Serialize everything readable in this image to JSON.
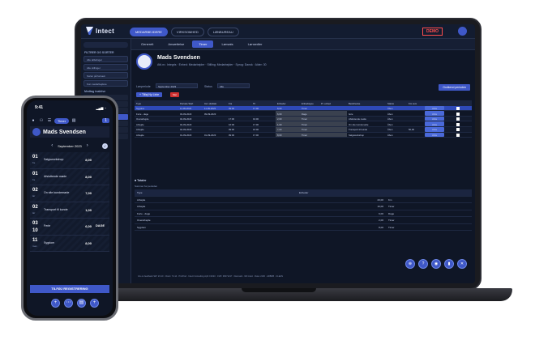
{
  "app": {
    "logo": "Intect",
    "demo_badge": "DEMO"
  },
  "topnav": [
    "MEDARBEJDERE",
    "VIRKSOMHED",
    "LØNBUREAU"
  ],
  "tabs": [
    "Generelt",
    "Ansættelse",
    "Timer",
    "Lønsats",
    "Lønsedler"
  ],
  "sidebar": {
    "title": "FILTRER OG SORTER",
    "selects": [
      "Alle afdelinger",
      "Alle stillinger",
      "Sorter på fornavn",
      "Kun medarbejdere"
    ],
    "checkbox": "Medtag inaktive"
  },
  "profile": {
    "name": "Mads Svendsen",
    "meta": "Afd.nr.: Integris · Enhed: Medarbejder · Stilling: Medarbejder · Sprog: Dansk · Alder: 30"
  },
  "filters": {
    "period_label": "Lønperiode",
    "period_value": "September 2023",
    "status_label": "Status",
    "status_value": "Alle",
    "add_button": "+ Tilføj Ny Linie",
    "delete_button": "Slet",
    "approve_button": "Godkend perioden"
  },
  "table": {
    "headers": [
      "Type",
      "Periode Start",
      "Ind. slutdato",
      "Fra",
      "Til",
      "Enheder",
      "Enhedstype",
      "Pr. enhed",
      "Beskrivelse",
      "Status",
      "Km sum",
      "",
      ""
    ],
    "rows": [
      [
        "Sygdom",
        "11-09-2023",
        "11-09-2023",
        "09:00",
        "17:00",
        "8,00",
        "Timer",
        "",
        "",
        "Åben",
        "",
        "Afvis",
        ""
      ],
      [
        "Ferie - dage",
        "03-09-2023",
        "09-09-2023",
        "",
        "",
        "6,00",
        "Dage",
        "",
        "ferie",
        "Åben",
        "",
        "Afvis",
        ""
      ],
      [
        "Overarbejde",
        "02-09-2023",
        "",
        "17:00",
        "19:00",
        "2,00",
        "Timer",
        "",
        "Afsluttende møde",
        "Åben",
        "",
        "Afvis",
        ""
      ],
      [
        "Arbejde",
        "02-09-2023",
        "",
        "16:00",
        "17:00",
        "1,00",
        "Timer",
        "",
        "On site kundemøde",
        "Åben",
        "",
        "Afvis",
        ""
      ],
      [
        "Arbejde",
        "02-09-2023",
        "",
        "09:00",
        "16:00",
        "7,00",
        "Timer",
        "",
        "Transport til kunde",
        "Åben",
        "50,00",
        "Afvis",
        ""
      ],
      [
        "Arbejde",
        "01-09-2023",
        "01-09-2023",
        "09:00",
        "17:00",
        "8,00",
        "Timer",
        "",
        "Salgsworkshop",
        "Åben",
        "",
        "Afvis",
        ""
      ]
    ]
  },
  "totals": {
    "title": "Totaler",
    "subtitle": "Summer for perioden",
    "headers": [
      "Type",
      "Enheder",
      ""
    ],
    "rows": [
      [
        "Arbejde",
        "23,00",
        "Km"
      ],
      [
        "Arbejde",
        "16,00",
        "Timer"
      ],
      [
        "Ferie - dage",
        "6,00",
        "Dage"
      ],
      [
        "Overarbejde",
        "2,00",
        "Timer"
      ],
      [
        "Sygdom",
        "8,00",
        "Timer"
      ]
    ]
  },
  "fab_icons": [
    "person-add",
    "help",
    "chat",
    "bookmark",
    "close"
  ],
  "footer": "Giv os feedback   SW: 23.10 · Client: 74.14 · ProProd · Intect Consulting ApS ©2023 · CVR: 38271217 · Danmark · Mit Intect · Data: 2100 · ARBDB · CLEAN",
  "phone": {
    "time": "9:41",
    "signal": "▂▄▆ ◔",
    "tab": "Timer",
    "badge": "1",
    "name": "Mads Svendsen",
    "month": "September 2023",
    "items": [
      {
        "day": "01",
        "dow": "fre",
        "label": "Salgsworkshop",
        "value": "8,00",
        "unit": ""
      },
      {
        "day": "01",
        "dow": "fre",
        "label": "Afsluttende møde",
        "value": "8,00",
        "unit": ""
      },
      {
        "day": "02",
        "dow": "lør",
        "label": "On site kundemøde",
        "value": "7,00",
        "unit": ""
      },
      {
        "day": "02",
        "dow": "lør",
        "label": "Transport til kunde",
        "value": "1,00",
        "unit": ""
      },
      {
        "day": "03",
        "dow": "søn",
        "day2": "10",
        "label": "Ferie",
        "value": "6,00",
        "unit": "DAGE"
      },
      {
        "day": "11",
        "dow": "man",
        "label": "Sygdom",
        "value": "8,00",
        "unit": ""
      }
    ],
    "register_button": "TILFØJ REGISTRERING",
    "fabs": [
      "+",
      "⋯",
      "▤",
      "+"
    ]
  }
}
